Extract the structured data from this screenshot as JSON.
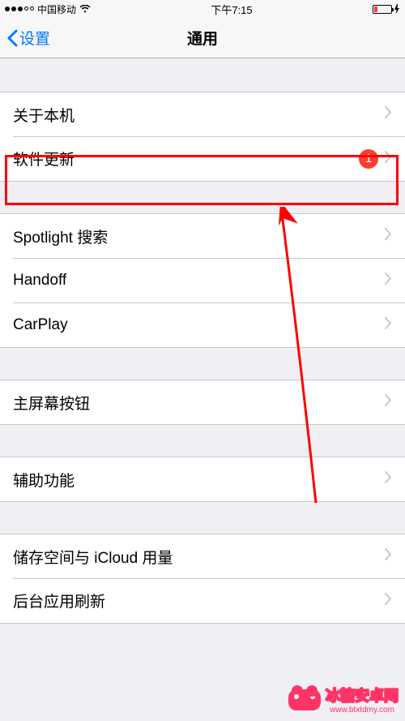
{
  "status_bar": {
    "carrier": "中国移动",
    "time": "下午7:15"
  },
  "nav": {
    "back_label": "设置",
    "title": "通用"
  },
  "groups": [
    {
      "cells": [
        {
          "label": "关于本机",
          "badge": null
        },
        {
          "label": "软件更新",
          "badge": "1"
        }
      ]
    },
    {
      "cells": [
        {
          "label": "Spotlight 搜索",
          "badge": null
        },
        {
          "label": "Handoff",
          "badge": null
        },
        {
          "label": "CarPlay",
          "badge": null
        }
      ]
    },
    {
      "cells": [
        {
          "label": "主屏幕按钮",
          "badge": null
        }
      ]
    },
    {
      "cells": [
        {
          "label": "辅助功能",
          "badge": null
        }
      ]
    },
    {
      "cells": [
        {
          "label": "储存空间与 iCloud 用量",
          "badge": null
        },
        {
          "label": "后台应用刷新",
          "badge": null
        }
      ]
    }
  ],
  "watermark": {
    "text": "冰糖安卓网",
    "url": "www.btxtdmy.com"
  },
  "annotation": {
    "highlight_cell_index": 1,
    "colors": {
      "highlight": "#ff0000",
      "badge": "#ff3b30",
      "accent": "#007aff"
    }
  }
}
